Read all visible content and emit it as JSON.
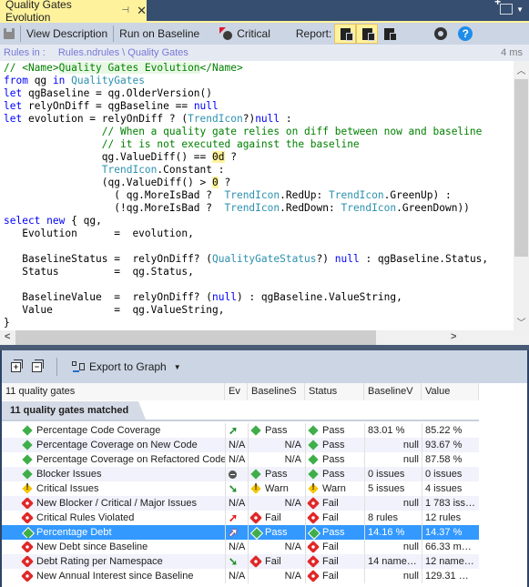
{
  "window": {
    "tab_title": "Quality Gates Evolution",
    "pin_icon": "pin-icon",
    "close_icon": "close-icon"
  },
  "toolbar": {
    "save_icon": "floppy-icon",
    "view_description": "View Description",
    "run_on_baseline": "Run on Baseline",
    "critical": "Critical",
    "report_label": "Report:",
    "report_buttons": [
      {
        "icon": "report-chart-icon",
        "active": true
      },
      {
        "icon": "report-window-icon",
        "active": true
      },
      {
        "icon": "report-grid-icon",
        "active": false
      }
    ],
    "settings_icon": "gear-icon",
    "help_icon": "help-icon",
    "help_glyph": "?"
  },
  "pathbar": {
    "label": "Rules in :",
    "path": "Rules.ndrules \\ Quality Gates",
    "elapsed": "4 ms"
  },
  "code": {
    "lines": [
      "// <Name>Quality Gates Evolution</Name>",
      "from qg in QualityGates",
      "let qgBaseline = qg.OlderVersion()",
      "let relyOnDiff = qgBaseline == null",
      "let evolution = relyOnDiff ? (TrendIcon?)null :",
      "                // When a quality gate relies on diff between now and baseline",
      "                // it is not executed against the baseline",
      "                qg.ValueDiff() == 0d ?",
      "                TrendIcon.Constant :",
      "                (qg.ValueDiff() > 0 ?",
      "                  ( qg.MoreIsBad ?  TrendIcon.RedUp: TrendIcon.GreenUp) :",
      "                  (!qg.MoreIsBad ?  TrendIcon.RedDown: TrendIcon.GreenDown))",
      "select new { qg,",
      "   Evolution      =  evolution,",
      "",
      "   BaselineStatus =  relyOnDiff? (QualityGateStatus?) null : qgBaseline.Status,",
      "   Status         =  qg.Status,",
      "",
      "   BaselineValue  =  relyOnDiff? (null) : qgBaseline.ValueString,",
      "   Value          =  qg.ValueString,",
      "}"
    ]
  },
  "results_toolbar": {
    "expand_icon": "expand-all-icon",
    "collapse_icon": "collapse-all-icon",
    "export_label": "Export to Graph"
  },
  "grid": {
    "columns": [
      "11 quality gates",
      "Ev",
      "BaselineS",
      "Status",
      "BaselineV",
      "Value"
    ],
    "group_label": "11 quality gates matched",
    "rows": [
      {
        "icon": "pass",
        "name": "Percentage Code Coverage",
        "ev": "gup",
        "ev_text": "",
        "bs_icon": "pass",
        "bs": "Pass",
        "st_icon": "pass",
        "st": "Pass",
        "bv": "83.01 %",
        "bv_align": "left",
        "v": "85.22 %"
      },
      {
        "icon": "pass",
        "name": "Percentage Coverage on New Code",
        "ev": "na",
        "ev_text": "N/A",
        "bs_icon": "",
        "bs": "N/A",
        "st_icon": "pass",
        "st": "Pass",
        "bv": "null",
        "bv_align": "right",
        "v": "93.67 %"
      },
      {
        "icon": "pass",
        "name": "Percentage Coverage on Refactored Code",
        "ev": "na",
        "ev_text": "N/A",
        "bs_icon": "",
        "bs": "N/A",
        "st_icon": "pass",
        "st": "Pass",
        "bv": "null",
        "bv_align": "right",
        "v": "87.58 %"
      },
      {
        "icon": "pass",
        "name": "Blocker Issues",
        "ev": "const",
        "ev_text": "",
        "bs_icon": "pass",
        "bs": "Pass",
        "st_icon": "pass",
        "st": "Pass",
        "bv": "0 issues",
        "bv_align": "left",
        "v": "0 issues"
      },
      {
        "icon": "warn",
        "name": "Critical Issues",
        "ev": "gdown",
        "ev_text": "",
        "bs_icon": "warn",
        "bs": "Warn",
        "st_icon": "warn",
        "st": "Warn",
        "bv": "5 issues",
        "bv_align": "left",
        "v": "4 issues"
      },
      {
        "icon": "fail",
        "name": "New Blocker / Critical / Major Issues",
        "ev": "na",
        "ev_text": "N/A",
        "bs_icon": "",
        "bs": "N/A",
        "st_icon": "fail",
        "st": "Fail",
        "bv": "null",
        "bv_align": "right",
        "v": "1 783 iss…"
      },
      {
        "icon": "fail",
        "name": "Critical Rules Violated",
        "ev": "rup",
        "ev_text": "",
        "bs_icon": "fail",
        "bs": "Fail",
        "st_icon": "fail",
        "st": "Fail",
        "bv": "8 rules",
        "bv_align": "left",
        "v": "12 rules"
      },
      {
        "icon": "pass",
        "name": "Percentage Debt",
        "ev": "rup",
        "ev_text": "",
        "bs_icon": "pass",
        "bs": "Pass",
        "st_icon": "pass",
        "st": "Pass",
        "bv": "14.16 %",
        "bv_align": "left",
        "v": "14.37 %",
        "selected": true
      },
      {
        "icon": "fail",
        "name": "New Debt since Baseline",
        "ev": "na",
        "ev_text": "N/A",
        "bs_icon": "",
        "bs": "N/A",
        "st_icon": "fail",
        "st": "Fail",
        "bv": "null",
        "bv_align": "right",
        "v": "66.33 m…"
      },
      {
        "icon": "fail",
        "name": "Debt Rating per Namespace",
        "ev": "gdown",
        "ev_text": "",
        "bs_icon": "fail",
        "bs": "Fail",
        "st_icon": "fail",
        "st": "Fail",
        "bv": "14 name…",
        "bv_align": "left",
        "v": "12 name…"
      },
      {
        "icon": "fail",
        "name": "New Annual Interest since Baseline",
        "ev": "na",
        "ev_text": "N/A",
        "bs_icon": "",
        "bs": "N/A",
        "st_icon": "fail",
        "st": "Fail",
        "bv": "null",
        "bv_align": "right",
        "v": "129.31 …"
      }
    ]
  },
  "colors": {
    "accent_yellow": "#fff29d",
    "selection": "#3399ff",
    "pass": "#3fae49",
    "warn": "#f5c400",
    "fail": "#e02828"
  }
}
